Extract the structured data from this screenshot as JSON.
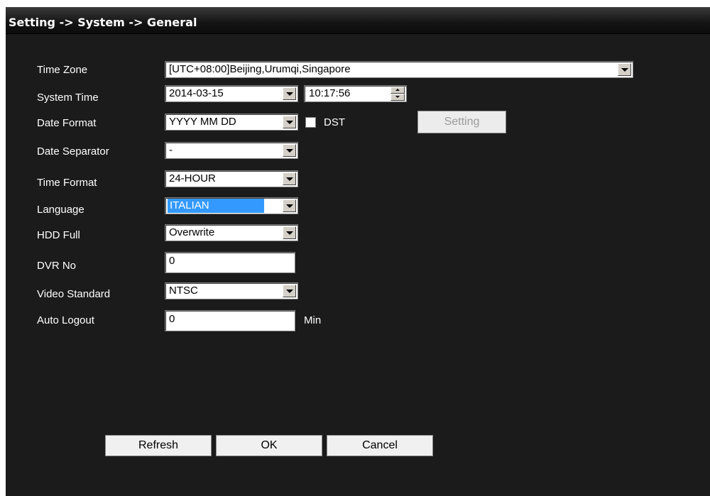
{
  "title": "Setting -> System -> General",
  "fields": {
    "time_zone": {
      "label": "Time Zone",
      "value": "[UTC+08:00]Beijing,Urumqi,Singapore"
    },
    "system_time": {
      "label": "System Time",
      "date": "2014-03-15",
      "time": "10:17:56"
    },
    "date_format": {
      "label": "Date Format",
      "value": "YYYY MM DD"
    },
    "dst": {
      "label": "DST",
      "checked": false
    },
    "setting_button": "Setting",
    "date_separator": {
      "label": "Date Separator",
      "value": "-"
    },
    "time_format": {
      "label": "Time Format",
      "value": "24-HOUR"
    },
    "language": {
      "label": "Language",
      "value": "ITALIAN"
    },
    "hdd_full": {
      "label": "HDD Full",
      "value": "Overwrite"
    },
    "dvr_no": {
      "label": "DVR No",
      "value": "0"
    },
    "video_standard": {
      "label": "Video Standard",
      "value": "NTSC"
    },
    "auto_logout": {
      "label": "Auto Logout",
      "value": "0",
      "unit": "Min"
    }
  },
  "buttons": {
    "refresh": "Refresh",
    "ok": "OK",
    "cancel": "Cancel"
  },
  "colors": {
    "background": "#1b1b1b",
    "text": "#ffffff",
    "selection": "#3399ff"
  }
}
